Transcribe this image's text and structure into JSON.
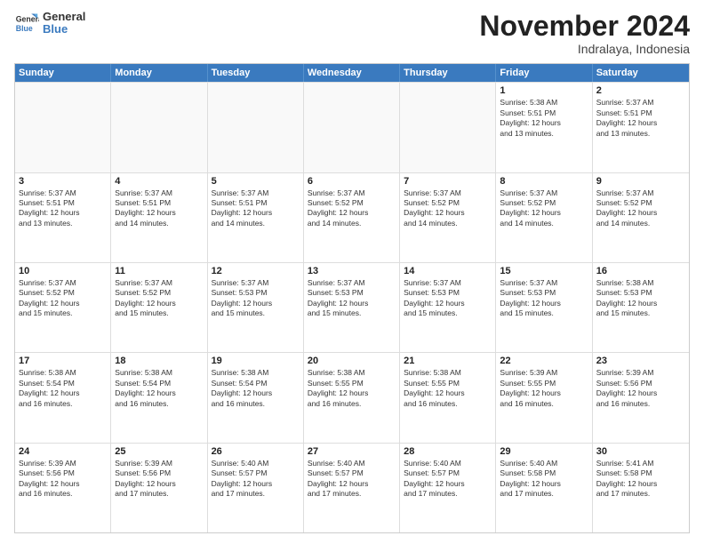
{
  "logo": {
    "line1": "General",
    "line2": "Blue"
  },
  "title": "November 2024",
  "subtitle": "Indralaya, Indonesia",
  "days_header": [
    "Sunday",
    "Monday",
    "Tuesday",
    "Wednesday",
    "Thursday",
    "Friday",
    "Saturday"
  ],
  "rows": [
    [
      {
        "day": "",
        "info": "",
        "empty": true
      },
      {
        "day": "",
        "info": "",
        "empty": true
      },
      {
        "day": "",
        "info": "",
        "empty": true
      },
      {
        "day": "",
        "info": "",
        "empty": true
      },
      {
        "day": "",
        "info": "",
        "empty": true
      },
      {
        "day": "1",
        "info": "Sunrise: 5:38 AM\nSunset: 5:51 PM\nDaylight: 12 hours\nand 13 minutes.",
        "empty": false
      },
      {
        "day": "2",
        "info": "Sunrise: 5:37 AM\nSunset: 5:51 PM\nDaylight: 12 hours\nand 13 minutes.",
        "empty": false
      }
    ],
    [
      {
        "day": "3",
        "info": "Sunrise: 5:37 AM\nSunset: 5:51 PM\nDaylight: 12 hours\nand 13 minutes.",
        "empty": false
      },
      {
        "day": "4",
        "info": "Sunrise: 5:37 AM\nSunset: 5:51 PM\nDaylight: 12 hours\nand 14 minutes.",
        "empty": false
      },
      {
        "day": "5",
        "info": "Sunrise: 5:37 AM\nSunset: 5:51 PM\nDaylight: 12 hours\nand 14 minutes.",
        "empty": false
      },
      {
        "day": "6",
        "info": "Sunrise: 5:37 AM\nSunset: 5:52 PM\nDaylight: 12 hours\nand 14 minutes.",
        "empty": false
      },
      {
        "day": "7",
        "info": "Sunrise: 5:37 AM\nSunset: 5:52 PM\nDaylight: 12 hours\nand 14 minutes.",
        "empty": false
      },
      {
        "day": "8",
        "info": "Sunrise: 5:37 AM\nSunset: 5:52 PM\nDaylight: 12 hours\nand 14 minutes.",
        "empty": false
      },
      {
        "day": "9",
        "info": "Sunrise: 5:37 AM\nSunset: 5:52 PM\nDaylight: 12 hours\nand 14 minutes.",
        "empty": false
      }
    ],
    [
      {
        "day": "10",
        "info": "Sunrise: 5:37 AM\nSunset: 5:52 PM\nDaylight: 12 hours\nand 15 minutes.",
        "empty": false
      },
      {
        "day": "11",
        "info": "Sunrise: 5:37 AM\nSunset: 5:52 PM\nDaylight: 12 hours\nand 15 minutes.",
        "empty": false
      },
      {
        "day": "12",
        "info": "Sunrise: 5:37 AM\nSunset: 5:53 PM\nDaylight: 12 hours\nand 15 minutes.",
        "empty": false
      },
      {
        "day": "13",
        "info": "Sunrise: 5:37 AM\nSunset: 5:53 PM\nDaylight: 12 hours\nand 15 minutes.",
        "empty": false
      },
      {
        "day": "14",
        "info": "Sunrise: 5:37 AM\nSunset: 5:53 PM\nDaylight: 12 hours\nand 15 minutes.",
        "empty": false
      },
      {
        "day": "15",
        "info": "Sunrise: 5:37 AM\nSunset: 5:53 PM\nDaylight: 12 hours\nand 15 minutes.",
        "empty": false
      },
      {
        "day": "16",
        "info": "Sunrise: 5:38 AM\nSunset: 5:53 PM\nDaylight: 12 hours\nand 15 minutes.",
        "empty": false
      }
    ],
    [
      {
        "day": "17",
        "info": "Sunrise: 5:38 AM\nSunset: 5:54 PM\nDaylight: 12 hours\nand 16 minutes.",
        "empty": false
      },
      {
        "day": "18",
        "info": "Sunrise: 5:38 AM\nSunset: 5:54 PM\nDaylight: 12 hours\nand 16 minutes.",
        "empty": false
      },
      {
        "day": "19",
        "info": "Sunrise: 5:38 AM\nSunset: 5:54 PM\nDaylight: 12 hours\nand 16 minutes.",
        "empty": false
      },
      {
        "day": "20",
        "info": "Sunrise: 5:38 AM\nSunset: 5:55 PM\nDaylight: 12 hours\nand 16 minutes.",
        "empty": false
      },
      {
        "day": "21",
        "info": "Sunrise: 5:38 AM\nSunset: 5:55 PM\nDaylight: 12 hours\nand 16 minutes.",
        "empty": false
      },
      {
        "day": "22",
        "info": "Sunrise: 5:39 AM\nSunset: 5:55 PM\nDaylight: 12 hours\nand 16 minutes.",
        "empty": false
      },
      {
        "day": "23",
        "info": "Sunrise: 5:39 AM\nSunset: 5:56 PM\nDaylight: 12 hours\nand 16 minutes.",
        "empty": false
      }
    ],
    [
      {
        "day": "24",
        "info": "Sunrise: 5:39 AM\nSunset: 5:56 PM\nDaylight: 12 hours\nand 16 minutes.",
        "empty": false
      },
      {
        "day": "25",
        "info": "Sunrise: 5:39 AM\nSunset: 5:56 PM\nDaylight: 12 hours\nand 17 minutes.",
        "empty": false
      },
      {
        "day": "26",
        "info": "Sunrise: 5:40 AM\nSunset: 5:57 PM\nDaylight: 12 hours\nand 17 minutes.",
        "empty": false
      },
      {
        "day": "27",
        "info": "Sunrise: 5:40 AM\nSunset: 5:57 PM\nDaylight: 12 hours\nand 17 minutes.",
        "empty": false
      },
      {
        "day": "28",
        "info": "Sunrise: 5:40 AM\nSunset: 5:57 PM\nDaylight: 12 hours\nand 17 minutes.",
        "empty": false
      },
      {
        "day": "29",
        "info": "Sunrise: 5:40 AM\nSunset: 5:58 PM\nDaylight: 12 hours\nand 17 minutes.",
        "empty": false
      },
      {
        "day": "30",
        "info": "Sunrise: 5:41 AM\nSunset: 5:58 PM\nDaylight: 12 hours\nand 17 minutes.",
        "empty": false
      }
    ]
  ]
}
